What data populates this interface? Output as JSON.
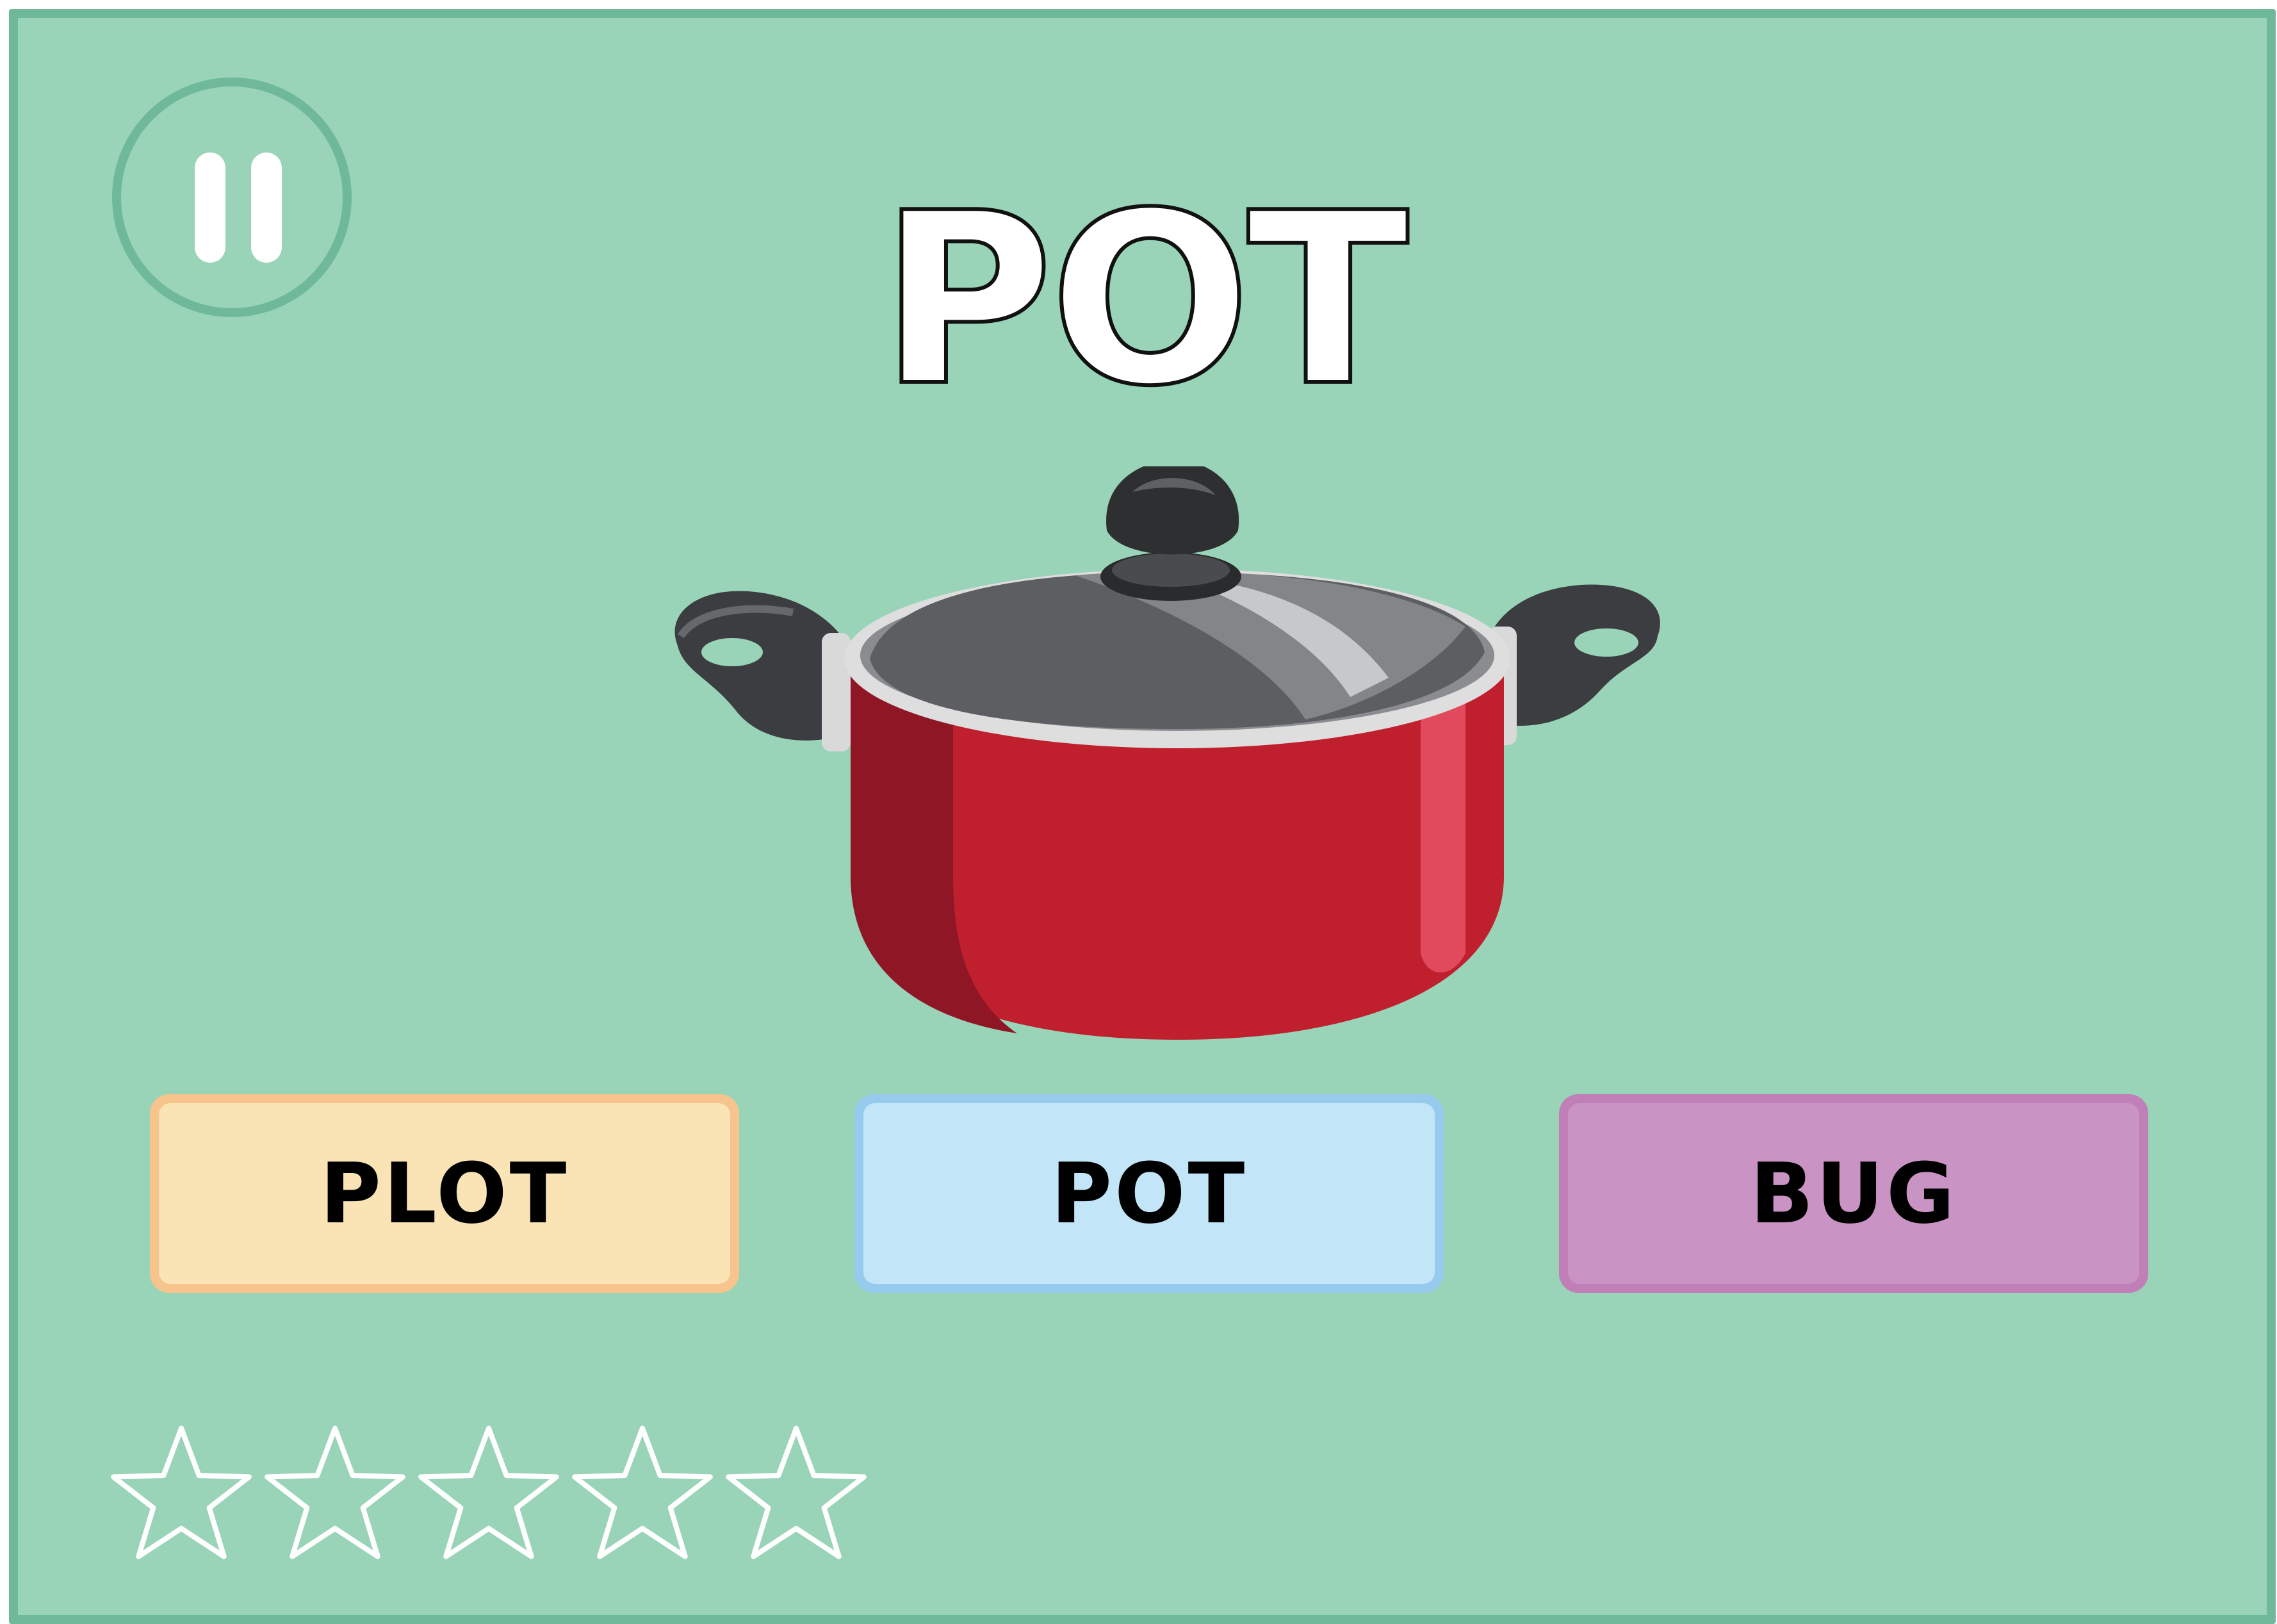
{
  "game": {
    "target_word": "POT",
    "picture": "cooking-pot-illustration",
    "choices": [
      {
        "label": "PLOT"
      },
      {
        "label": "POT"
      },
      {
        "label": "BUG"
      }
    ],
    "stars": {
      "earned": 0,
      "total": 5
    }
  },
  "controls": {
    "pause_icon": "pause-icon"
  },
  "colors": {
    "background": "#99d4b9",
    "frame_border": "#6fb89a",
    "choice_plot_fill": "#fae3b5",
    "choice_plot_border": "#f7c48d",
    "choice_pot_fill": "#c2e5f8",
    "choice_pot_border": "#96cbee",
    "choice_bug_fill": "#c993c3",
    "choice_bug_border": "#c07fb7",
    "pot_body": "#c01f2e",
    "pot_lid": "#6b6e73"
  }
}
